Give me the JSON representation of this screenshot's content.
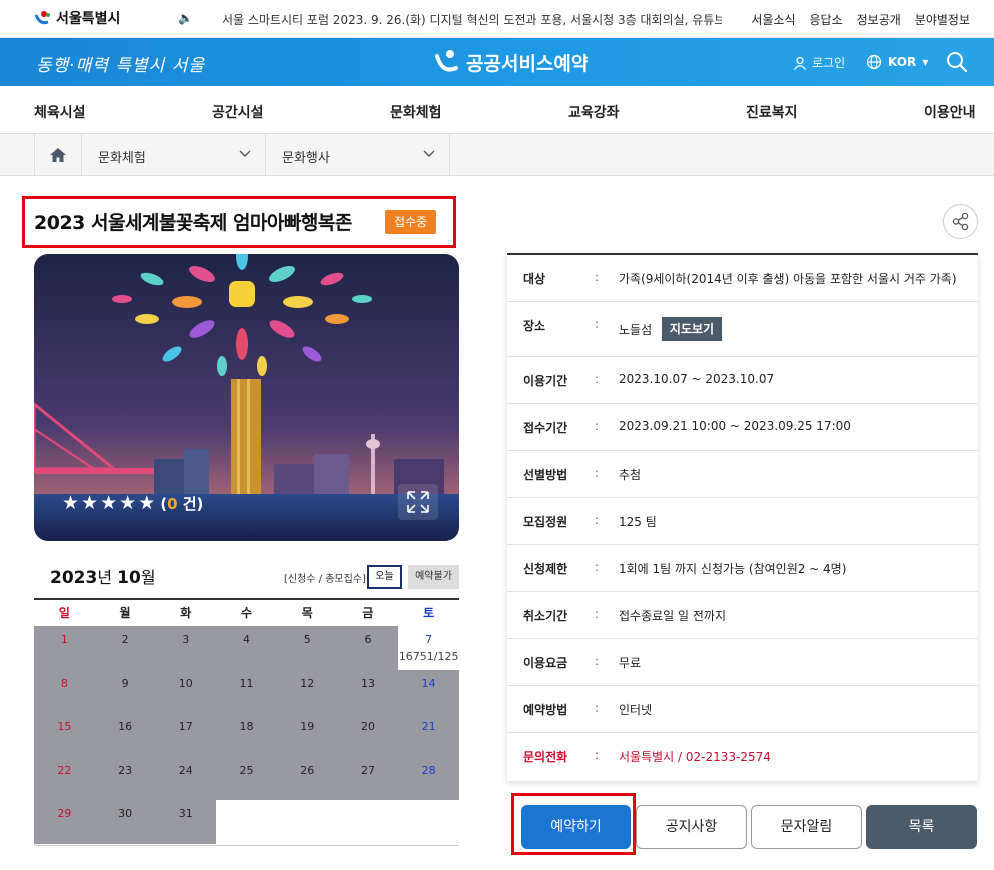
{
  "topbar": {
    "logo_text": "서울특별시",
    "ticker": "서울 스마트시티 포럼 2023. 9. 26.(화) 디지털 혁신의 도전과 포용, 서울시청 3층 대회의실, 유튜브 생중계",
    "links": [
      "서울소식",
      "응답소",
      "정보공개",
      "분야별정보"
    ]
  },
  "header": {
    "slogan": "동행·매력 특별시 서울",
    "service_title": "공공서비스예약",
    "login_label": "로그인",
    "lang_label": "KOR"
  },
  "nav": {
    "items": [
      "체육시설",
      "공간시설",
      "문화체험",
      "교육강좌",
      "진료복지",
      "이용안내"
    ]
  },
  "breadcrumb": {
    "level1": "문화체험",
    "level2": "문화행사"
  },
  "event": {
    "title": "2023 서울세계불꽃축제 엄마아빠행복존",
    "status": "접수중",
    "rating_count_prefix": "(",
    "rating_count": "0",
    "rating_count_suffix": " 건)"
  },
  "calendar": {
    "year": "2023",
    "year_suffix": "년 ",
    "month": "10",
    "month_suffix": "월",
    "legend": "[신청수 / 총모집수]",
    "today_label": "오늘",
    "unavailable_label": "예약불가",
    "weekdays": [
      "일",
      "월",
      "화",
      "수",
      "목",
      "금",
      "토"
    ],
    "weeks": [
      [
        "1",
        "2",
        "3",
        "4",
        "5",
        "6",
        "7"
      ],
      [
        "8",
        "9",
        "10",
        "11",
        "12",
        "13",
        "14"
      ],
      [
        "15",
        "16",
        "17",
        "18",
        "19",
        "20",
        "21"
      ],
      [
        "22",
        "23",
        "24",
        "25",
        "26",
        "27",
        "28"
      ],
      [
        "29",
        "30",
        "31",
        "",
        "",
        "",
        ""
      ]
    ],
    "available_day": "7",
    "available_day_count": "16751/125"
  },
  "info": {
    "rows": [
      {
        "key": "대상",
        "value": "가족(9세이하(2014년 이후 출생) 아동을 포함한 서울시 거주 가족)"
      },
      {
        "key": "장소",
        "value": "노들섬"
      },
      {
        "key": "이용기간",
        "value": "2023.10.07 ~ 2023.10.07"
      },
      {
        "key": "접수기간",
        "value": "2023.09.21 10:00 ~ 2023.09.25 17:00"
      },
      {
        "key": "선별방법",
        "value": "추첨"
      },
      {
        "key": "모집정원",
        "value": "125 팀"
      },
      {
        "key": "신청제한",
        "value": "1회에 1팀 까지 신청가능 (참여인원2 ~ 4명)"
      },
      {
        "key": "취소기간",
        "value": "접수종료일 일 전까지"
      },
      {
        "key": "이용요금",
        "value": "무료"
      },
      {
        "key": "예약방법",
        "value": "인터넷"
      },
      {
        "key": "문의전화",
        "value": "서울특별시 / 02-2133-2574"
      }
    ],
    "separator": ":",
    "map_button": "지도보기"
  },
  "actions": {
    "reserve": "예약하기",
    "notice": "공지사항",
    "sms": "문자알림",
    "list": "목록"
  },
  "colors": {
    "header_blue": "#1e9ae5",
    "status_orange": "#f08020",
    "reserve_blue": "#1a76d2",
    "highlight_red": "#e60012",
    "list_gray": "#4b5a6b"
  }
}
